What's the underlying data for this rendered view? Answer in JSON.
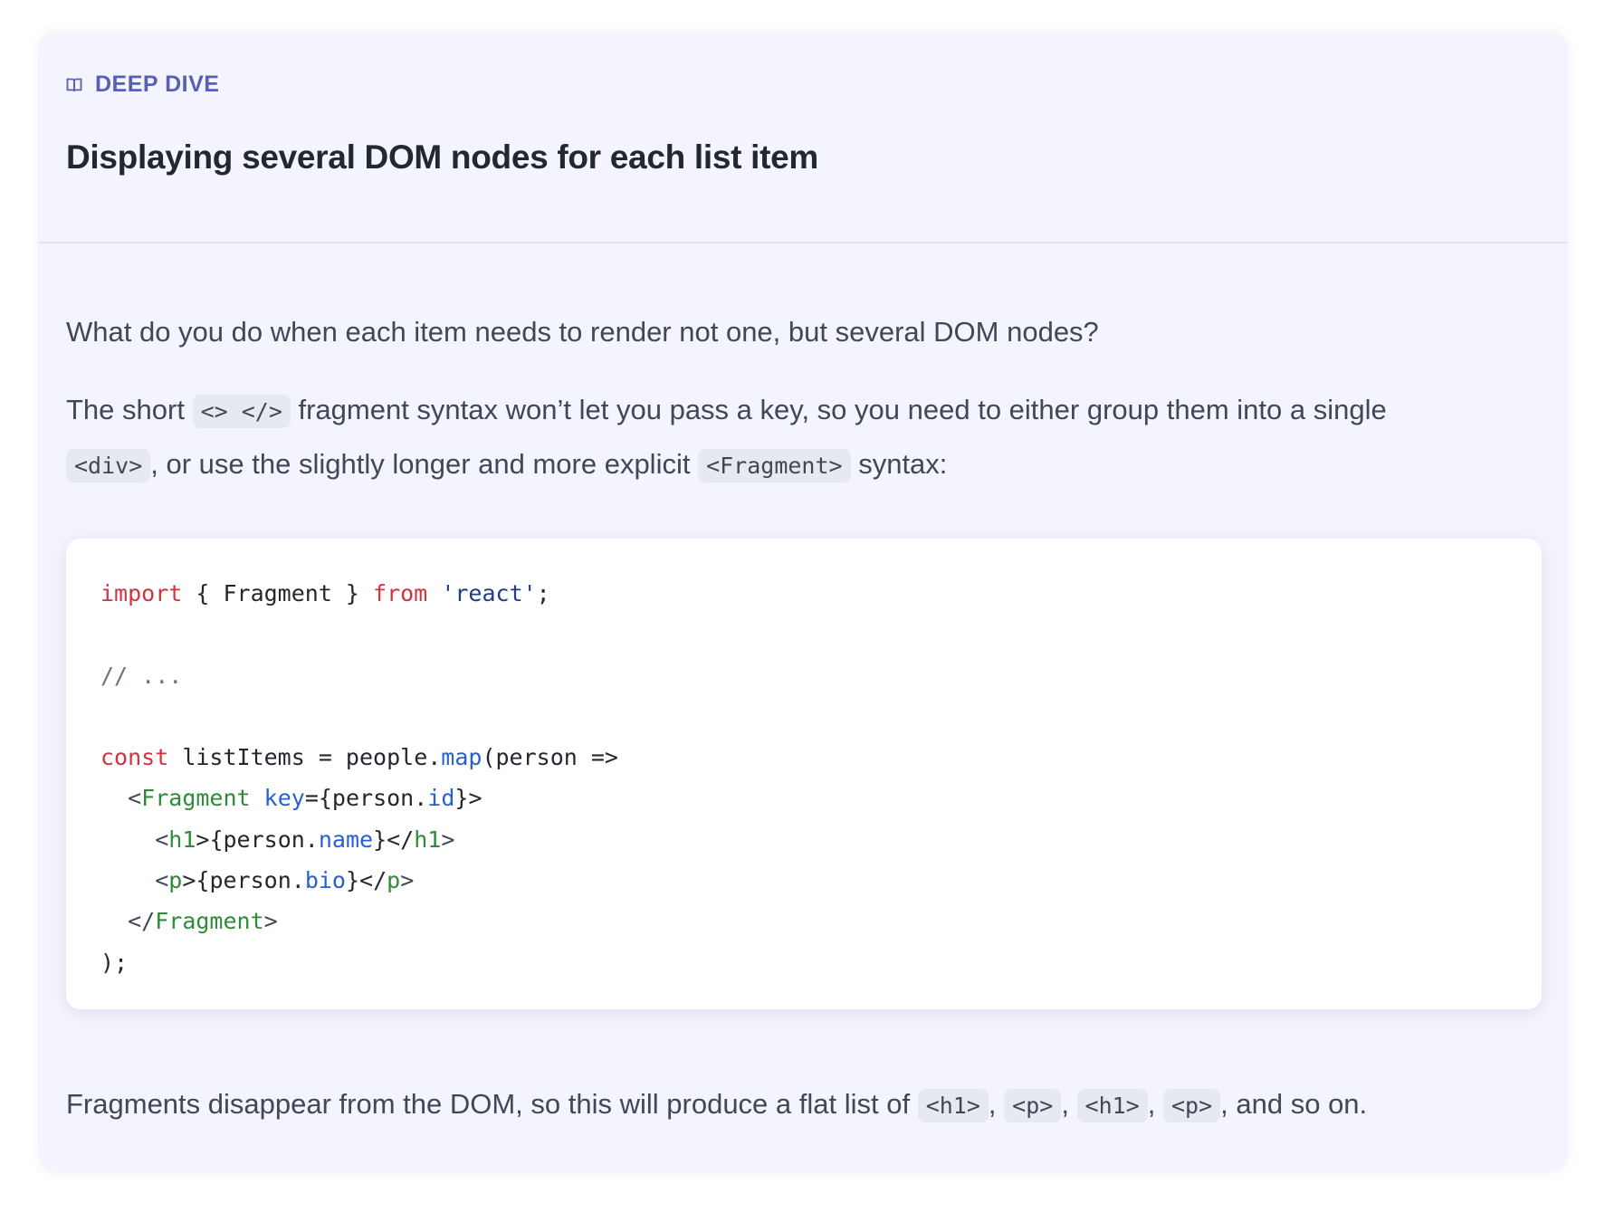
{
  "card": {
    "label": "DEEP DIVE",
    "title": "Displaying several DOM nodes for each list item"
  },
  "paragraph1": "What do you do when each item needs to render not one, but several DOM nodes?",
  "paragraph2": {
    "part1": "The short ",
    "code1": "<> </>",
    "part2": " fragment syntax won’t let you pass a key, so you need to either group them into a single",
    "code2": "<div>",
    "part3": ", or use the slightly longer and more explicit ",
    "code3": "<Fragment>",
    "part4": " syntax:"
  },
  "code": {
    "line1": {
      "kw1": "import",
      "mid": " { Fragment } ",
      "kw2": "from",
      "sp": " ",
      "str": "'react'",
      "end": ";"
    },
    "line3": "// ...",
    "line5": {
      "kw": "const",
      "a": " listItems = people.",
      "fn": "map",
      "b": "(person =>"
    },
    "line6": {
      "indent": "  ",
      "open": "<",
      "tag": "Fragment",
      "sp": " ",
      "attr": "key",
      "a": "={person.",
      "prop": "id",
      "b": "}>"
    },
    "line7": {
      "indent": "    ",
      "open": "<",
      "tag": "h1",
      "a": ">{person.",
      "prop": "name",
      "b": "}</",
      "tag2": "h1",
      "close": ">"
    },
    "line8": {
      "indent": "    ",
      "open": "<",
      "tag": "p",
      "a": ">{person.",
      "prop": "bio",
      "b": "}</",
      "tag2": "p",
      "close": ">"
    },
    "line9": {
      "indent": "  ",
      "open": "</",
      "tag": "Fragment",
      "close": ">"
    },
    "line10": ");"
  },
  "paragraph3": {
    "part1": "Fragments disappear from the DOM, so this will produce a flat list of ",
    "code1": "<h1>",
    "sep1": ", ",
    "code2": "<p>",
    "sep2": ", ",
    "code3": "<h1>",
    "sep3": ", ",
    "code4": "<p>",
    "part2": ", and so on."
  }
}
